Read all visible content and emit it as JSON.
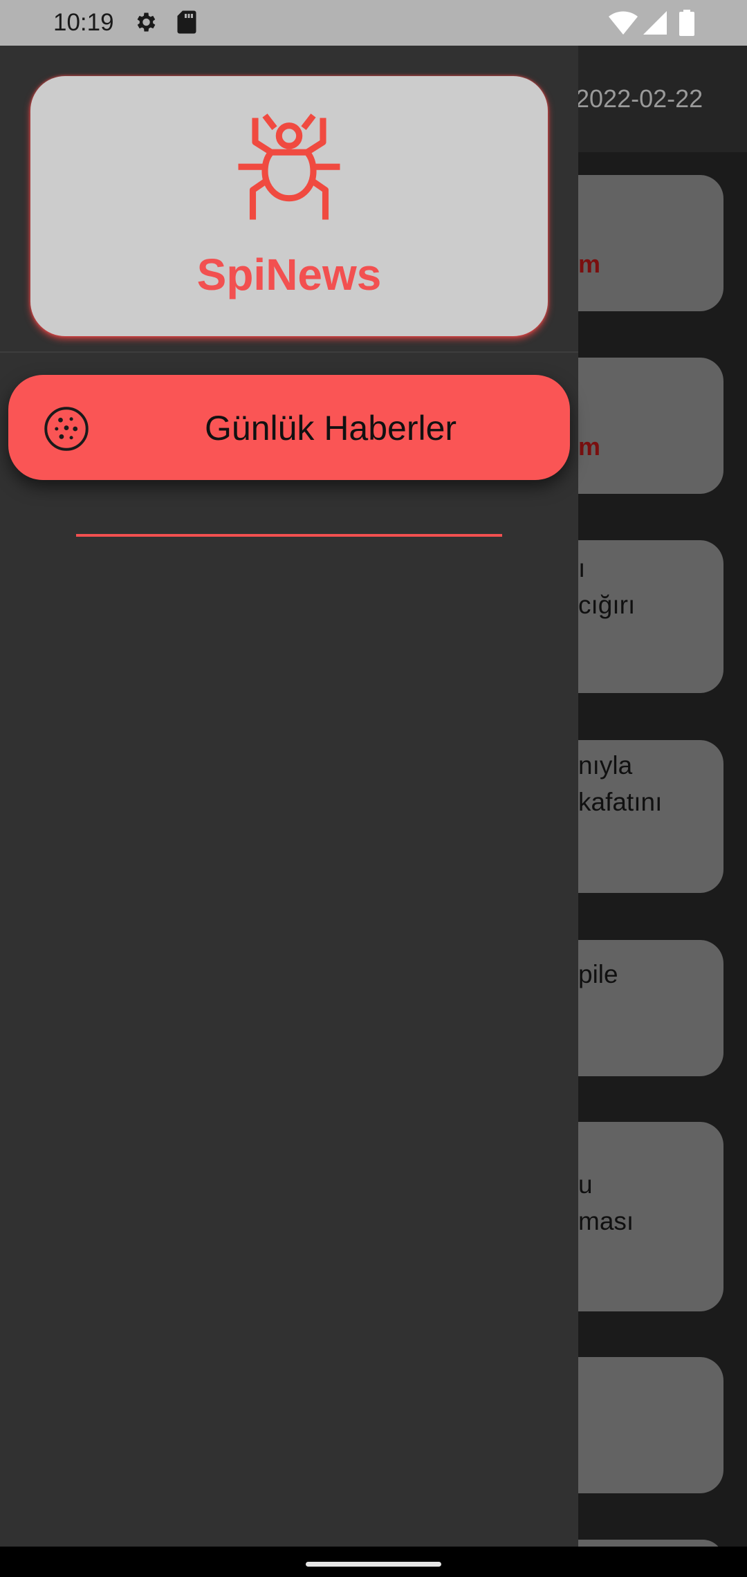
{
  "status_bar": {
    "time": "10:19",
    "icons": [
      "settings-icon",
      "sd-card-icon",
      "wifi-icon",
      "cell-signal-icon",
      "battery-icon"
    ]
  },
  "app_bar": {
    "date": "2022-02-22"
  },
  "news_cards": [
    {
      "lines": "m"
    },
    {
      "lines": "m"
    },
    {
      "lines": "ı\ncığırı"
    },
    {
      "lines": "nıyla\nkafatını"
    },
    {
      "lines": "pile"
    },
    {
      "lines": "u\nması"
    },
    {
      "lines": ""
    }
  ],
  "drawer": {
    "app_name": "SpiNews",
    "logo_icon": "spider-icon",
    "menu_items": [
      {
        "label": "Günlük Haberler",
        "icon": "cookie-icon"
      }
    ]
  },
  "colors": {
    "accent": "#f25050",
    "menu_active": "#fa5555",
    "drawer_bg": "#313131",
    "header_card": "#cccccc"
  }
}
